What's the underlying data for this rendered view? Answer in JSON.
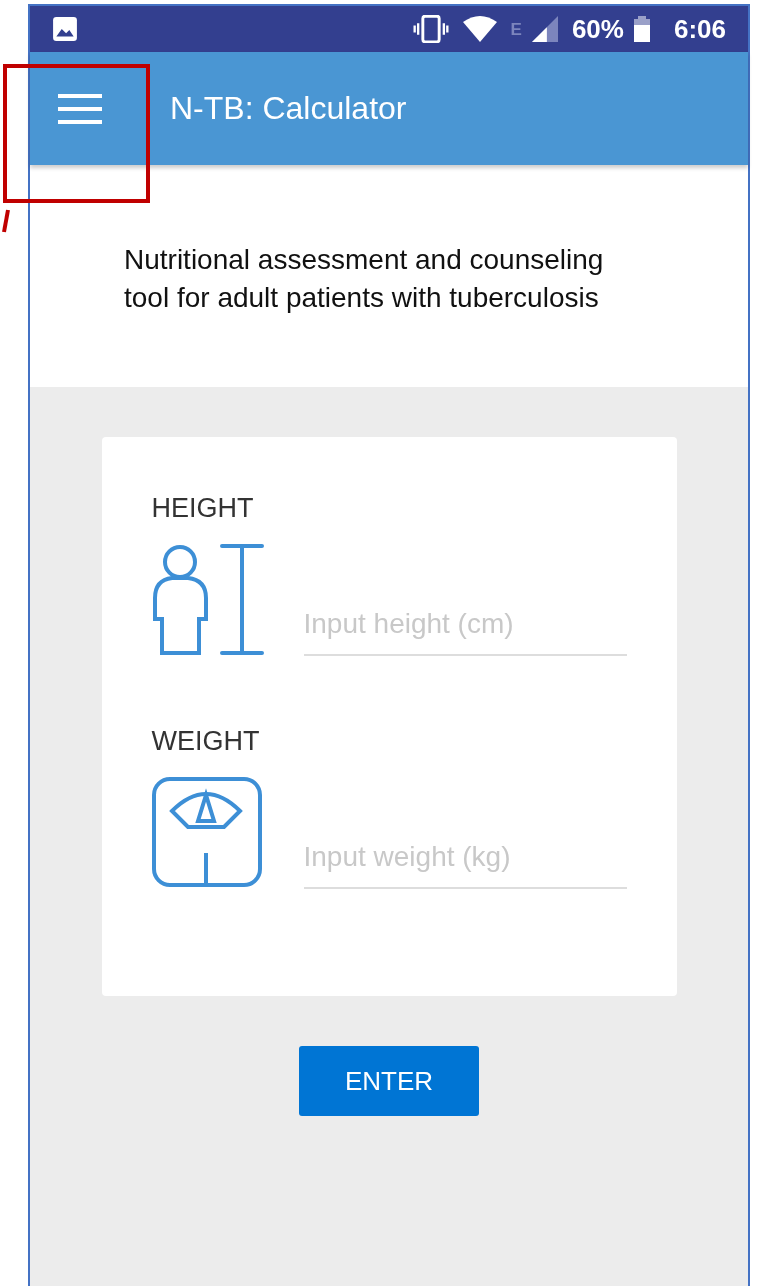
{
  "status_bar": {
    "network": "E",
    "battery": "60%",
    "time": "6:06"
  },
  "app_bar": {
    "title": "N-TB: Calculator"
  },
  "description": "Nutritional assessment and counseling tool for adult patients with tuberculosis",
  "fields": [
    {
      "kind": "height",
      "label": "HEIGHT",
      "placeholder": "Input height (cm)"
    },
    {
      "kind": "weight",
      "label": "WEIGHT",
      "placeholder": "Input weight (kg)"
    }
  ],
  "button": "ENTER"
}
